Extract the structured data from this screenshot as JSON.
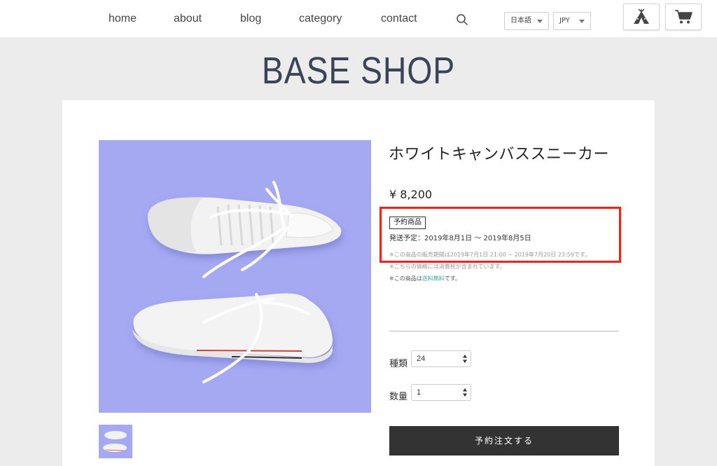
{
  "nav": {
    "items": [
      "home",
      "about",
      "blog",
      "category",
      "contact"
    ],
    "language": "日本語",
    "currency": "JPY"
  },
  "icons": {
    "search": "search-icon",
    "tent": "tent-icon",
    "cart": "cart-icon"
  },
  "shop": {
    "name": "BASE SHOP"
  },
  "product": {
    "title": "ホワイトキャンバススニーカー",
    "price": "¥ 8,200",
    "badge": "予約商品",
    "ship_date": "発送予定：2019年8月1日 〜 2019年8月5日",
    "sale_period": "※この商品の販売期間は2019年7月1日 21:00 ~ 2019年7月20日 23:59です。",
    "tax_note": "※こちらの価格には消費税が含まれています。",
    "shipping_note_prefix": "※この商品は",
    "shipping_note_link": "送料無料",
    "shipping_note_suffix": "です。",
    "options": {
      "type_label": "種類",
      "type_value": "24",
      "qty_label": "数量",
      "qty_value": "1"
    },
    "order_button": "予約注文する"
  },
  "colors": {
    "image_bg": "#a5a9f2",
    "highlight": "#e8261b",
    "button_bg": "#333333",
    "free_shipping": "#2aa89a"
  }
}
